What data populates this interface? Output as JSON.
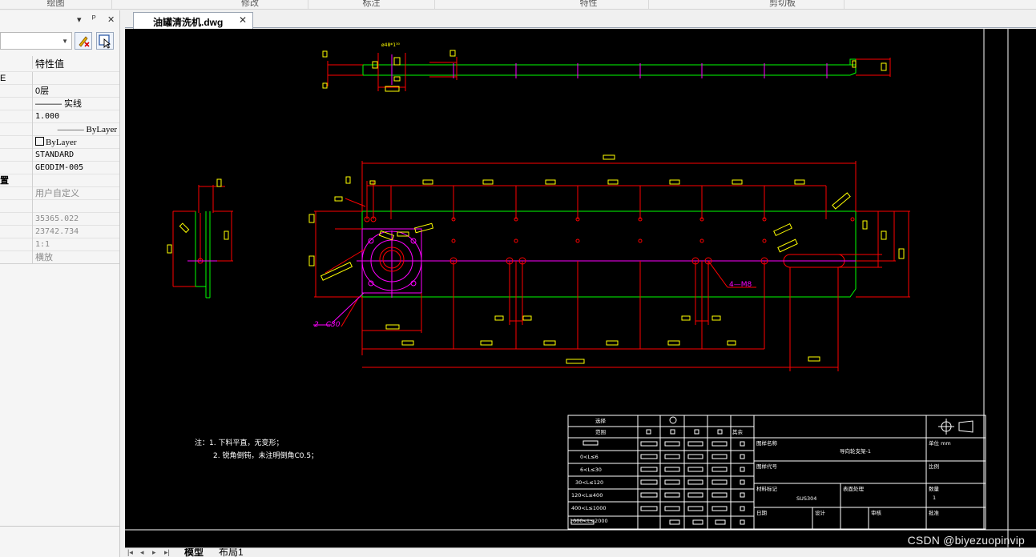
{
  "ribbon": {
    "groups": [
      "绘图",
      "修改",
      "标注",
      "特性",
      "剪切板"
    ]
  },
  "palette": {
    "title_buttons": [
      "▾",
      "ᴾ",
      "✕"
    ],
    "column_header": "特性值",
    "rows": [
      {
        "label": "E",
        "value": ""
      },
      {
        "label": "",
        "value": "0层"
      },
      {
        "label": "",
        "value": "——— 实线"
      },
      {
        "label": "",
        "value": "1.000"
      },
      {
        "label": "",
        "value": "——— ByLayer"
      },
      {
        "label": "",
        "value": "ByLayer"
      },
      {
        "label": "",
        "value": "STANDARD"
      },
      {
        "label": "",
        "value": "GEODIM-005"
      },
      {
        "label": "置",
        "value": ""
      },
      {
        "label": "",
        "value": "用户自定义"
      },
      {
        "label": "",
        "value": ""
      },
      {
        "label": "",
        "value": "35365.022"
      },
      {
        "label": "",
        "value": "23742.734"
      },
      {
        "label": "",
        "value": "1:1"
      },
      {
        "label": "",
        "value": "横放"
      }
    ]
  },
  "document_tab": {
    "title": "油罐清洗机.dwg",
    "close": "✕"
  },
  "drawing": {
    "notes": {
      "line1": "注：1. 下料平直，无变形；",
      "line2": "2. 锐角倒钝，未注明倒角C0.5；"
    },
    "callouts": {
      "holes": "4—M8",
      "chamfer": "2—C30",
      "top_symbol": "ø48*1³⁰"
    },
    "title_block": {
      "method": "选择",
      "range": "范围",
      "drawing_name_label": "图样名称",
      "drawing_name": "导向轮支架-1",
      "drawing_no_label": "图样代号",
      "unit_label": "单位 mm",
      "scale_label": "比例",
      "material_label": "材料标记",
      "material": "SUS304",
      "surface_label": "表面处理",
      "quantity_label": "数量",
      "quantity": "1",
      "date_label": "日期",
      "design_label": "设计",
      "review_label": "审核",
      "approve_label": "批准",
      "tolerance_rows": [
        "0<L≤6",
        "6<L≤30",
        "30<L≤120",
        "120<L≤400",
        "400<L≤1000",
        "1000<L≤2000"
      ],
      "remark": "其余"
    }
  },
  "layout_tabs": {
    "nav": [
      "|◂",
      "◂",
      "▸",
      "▸|"
    ],
    "tabs": [
      "模型",
      "布局1"
    ]
  },
  "watermark": "CSDN @biyezuopinvip",
  "colors": {
    "canvas": "#000000",
    "dimension": "#ff0000",
    "outline": "#00ff00",
    "center": "#ff00ff",
    "text_box": "#ffff00",
    "border": "#ffffff"
  }
}
